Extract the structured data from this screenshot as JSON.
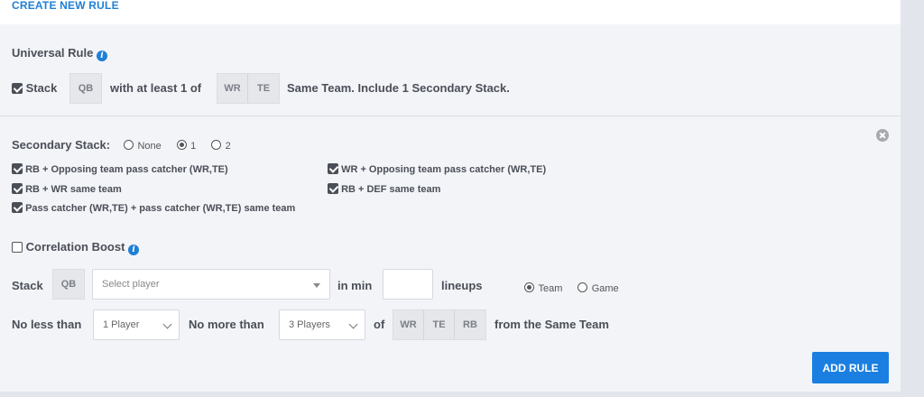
{
  "header": {
    "title": "CREATE NEW RULE"
  },
  "universal": {
    "title": "Universal Rule",
    "stack_label": "Stack",
    "primary_pos": "QB",
    "with_text": "with at least 1 of",
    "positions": [
      "WR",
      "TE"
    ],
    "suffix": "Same Team. Include 1 Secondary Stack."
  },
  "secondary": {
    "label": "Secondary Stack:",
    "options": [
      "None",
      "1",
      "2"
    ],
    "selected": "1",
    "checks": [
      "RB + Opposing team pass catcher (WR,TE)",
      "WR + Opposing team pass catcher (WR,TE)",
      "RB + WR same team",
      "RB + DEF same team",
      "Pass catcher (WR,TE) + pass catcher (WR,TE) same team"
    ]
  },
  "correlation": {
    "label": "Correlation Boost",
    "stack_label": "Stack",
    "pos": "QB",
    "select_placeholder": "Select player",
    "in_min": "in min",
    "lineups": "lineups",
    "scope_options": [
      "Team",
      "Game"
    ],
    "scope_selected": "Team",
    "no_less": "No less than",
    "min_value": "1 Player",
    "no_more": "No more than",
    "max_value": "3 Players",
    "of": "of",
    "positions": [
      "WR",
      "TE",
      "RB"
    ],
    "from_text": "from the Same Team"
  },
  "actions": {
    "add_rule": "ADD RULE"
  },
  "colors": {
    "accent": "#1f7fd4",
    "button": "#1a7fe0",
    "panel": "#f3f4f8"
  }
}
